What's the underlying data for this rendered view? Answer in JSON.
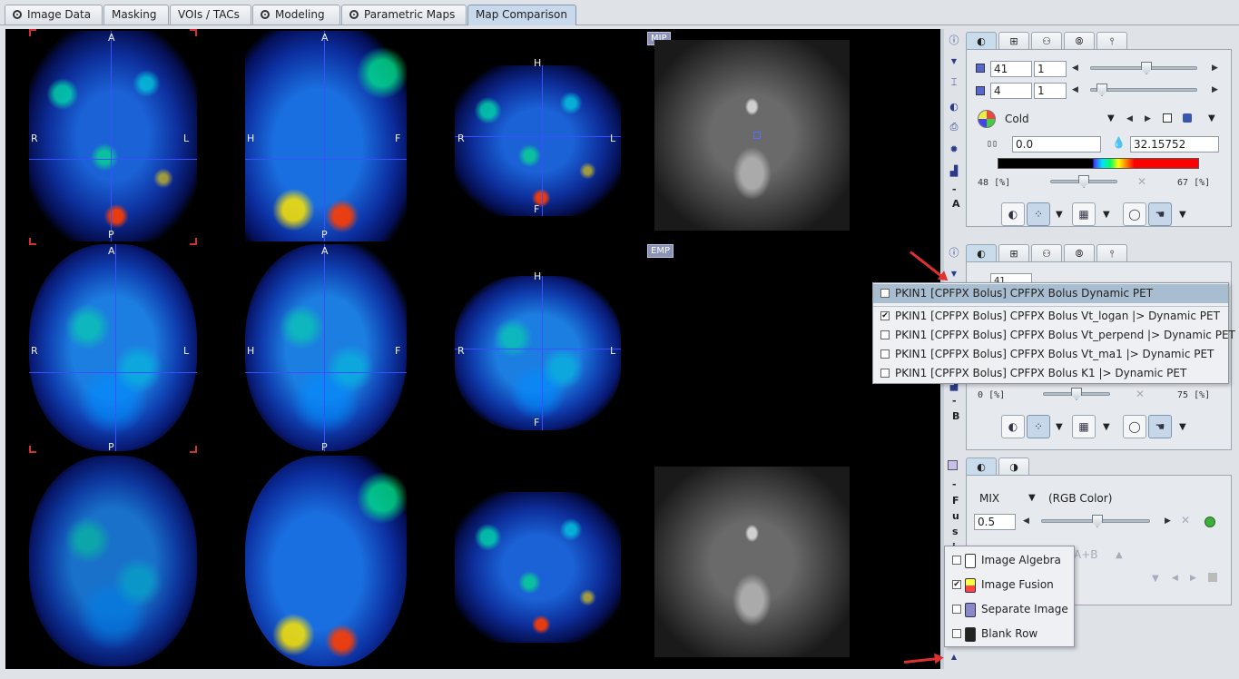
{
  "tabs": [
    {
      "label": "Image Data",
      "icon": "circle-dot-icon"
    },
    {
      "label": "Masking",
      "icon": ""
    },
    {
      "label": "VOIs / TACs",
      "icon": ""
    },
    {
      "label": "Modeling",
      "icon": "circle-dot-icon"
    },
    {
      "label": "Parametric Maps",
      "icon": "circle-dot-icon"
    },
    {
      "label": "Map Comparison",
      "icon": ""
    }
  ],
  "viewer": {
    "orientation": {
      "A": "A",
      "P": "P",
      "R": "R",
      "L": "L",
      "H": "H",
      "F": "F"
    },
    "mip_tag": "MIP",
    "emp_tag": "EMP"
  },
  "strips": {
    "a_label": "A",
    "b_label": "B",
    "fusion_label": "F u s i",
    "dash": "-"
  },
  "panel_a": {
    "plane_value": "41",
    "plane_step": "1",
    "frame_value": "4",
    "frame_step": "1",
    "colortable": "Cold",
    "min_value": "0.0",
    "max_value": "32.15752",
    "lower_pct": "48",
    "upper_pct": "67",
    "pct_unit": "[%]",
    "x_mark": "✕"
  },
  "panel_b": {
    "plane_value": "41",
    "lower_pct": "0",
    "upper_pct": "75",
    "pct_unit": "[%]",
    "x_mark": "✕"
  },
  "fusion_panel": {
    "mode": "MIX",
    "color_mode": "(RGB Color)",
    "ratio": "0.5",
    "ab_label": "A+B",
    "x_mark": "✕"
  },
  "series_menu": {
    "items": [
      {
        "label": "PKIN1 [CPFPX Bolus] CPFPX Bolus Dynamic PET",
        "checked": false,
        "selected": true
      },
      {
        "label": "PKIN1 [CPFPX Bolus] CPFPX Bolus Vt_logan |> Dynamic PET",
        "checked": true,
        "selected": false
      },
      {
        "label": "PKIN1 [CPFPX Bolus] CPFPX Bolus Vt_perpend |> Dynamic PET",
        "checked": false,
        "selected": false
      },
      {
        "label": "PKIN1 [CPFPX Bolus] CPFPX Bolus Vt_ma1 |> Dynamic PET",
        "checked": false,
        "selected": false
      },
      {
        "label": "PKIN1 [CPFPX Bolus] CPFPX Bolus K1 |> Dynamic PET",
        "checked": false,
        "selected": false
      }
    ]
  },
  "row_menu": {
    "items": [
      {
        "label": "Image Algebra",
        "checked": false
      },
      {
        "label": "Image Fusion",
        "checked": true
      },
      {
        "label": "Separate Image",
        "checked": false
      },
      {
        "label": "Blank Row",
        "checked": false
      }
    ]
  },
  "colors": {
    "accent": "#c7d9ea",
    "arrow": "#e03030",
    "crosshair": "#3a50ff",
    "selection": "#a9bdd1"
  }
}
